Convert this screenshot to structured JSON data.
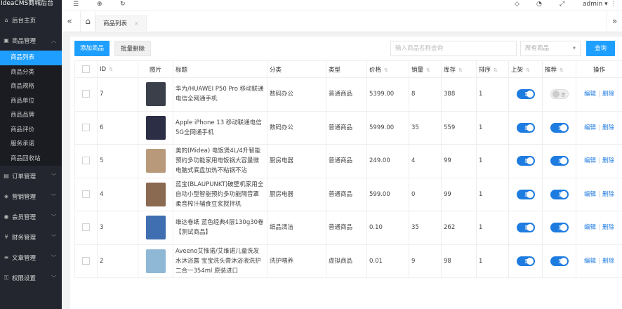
{
  "app": {
    "title": "IdeaCMS商城后台"
  },
  "sidebar": {
    "home": "后台主页",
    "goods": "商品管理",
    "sub": [
      "商品列表",
      "商品分类",
      "商品规格",
      "商品单位",
      "商品品牌",
      "商品评价",
      "服务承诺",
      "商品回收站"
    ],
    "groups": [
      "订单管理",
      "营销管理",
      "会员管理",
      "财务管理",
      "文章管理",
      "权限设置"
    ]
  },
  "topbar": {
    "user": "admin"
  },
  "tabs": {
    "current": "商品列表",
    "close": "×"
  },
  "toolbar": {
    "add": "添加商品",
    "batch_delete": "批量删除",
    "search_placeholder": "输入商品名称查询",
    "category_select": "所有商品",
    "search": "查询"
  },
  "table": {
    "headers": [
      "ID",
      "图片",
      "标题",
      "分类",
      "类型",
      "价格",
      "销量",
      "库存",
      "排序",
      "上架",
      "推荐",
      "操作"
    ],
    "rows": [
      {
        "id": "7",
        "title": "华为/HUAWEI P50 Pro 移动联通电信全网通手机",
        "cat": "数码办公",
        "type": "普通商品",
        "price": "5399.00",
        "sales": "8",
        "stock": "388",
        "sort": "1",
        "shelf": "是",
        "recommend": "否",
        "thumb": "#3a3f4a"
      },
      {
        "id": "6",
        "title": "Apple iPhone 13 移动联通电信5G全网通手机",
        "cat": "数码办公",
        "type": "普通商品",
        "price": "5999.00",
        "sales": "35",
        "stock": "559",
        "sort": "1",
        "shelf": "是",
        "recommend": "是",
        "thumb": "#2b2e45"
      },
      {
        "id": "5",
        "title": "美的(Midea) 电饭煲4L/4升智能预约多功能家用电饭锅大容量微电脑式底盘加热不粘锅不沾",
        "cat": "厨房电器",
        "type": "普通商品",
        "price": "249.00",
        "sales": "4",
        "stock": "99",
        "sort": "1",
        "shelf": "是",
        "recommend": "是",
        "thumb": "#b89a7a"
      },
      {
        "id": "4",
        "title": "蓝宝(BLAUPUNKT)破壁机家用全自动小型智能预约多功能隔音罩柔音榨汁辅食豆浆搅拌机",
        "cat": "厨房电器",
        "type": "普通商品",
        "price": "599.00",
        "sales": "0",
        "stock": "99",
        "sort": "1",
        "shelf": "是",
        "recommend": "是",
        "thumb": "#8b6a52"
      },
      {
        "id": "3",
        "title": "维达卷纸 蓝色经典4层130g30卷【测试商品】",
        "cat": "纸品清洁",
        "type": "普通商品",
        "price": "0.10",
        "sales": "35",
        "stock": "262",
        "sort": "1",
        "shelf": "是",
        "recommend": "是",
        "thumb": "#3f6fb0"
      },
      {
        "id": "2",
        "title": "Aveeno艾惟诺/艾维诺儿童洗发水沐浴露 宝宝洗头膏沐浴液洗护二合一354ml 原装进口",
        "cat": "洗护喂养",
        "type": "虚拟商品",
        "price": "0.01",
        "sales": "9",
        "stock": "98",
        "sort": "1",
        "shelf": "是",
        "recommend": "是",
        "thumb": "#8fb8d6"
      }
    ],
    "edit": "编辑",
    "delete": "删除"
  },
  "colors": {
    "accent": "#1e9fff",
    "sidebar": "#23262e",
    "switch_on": "#1e7be0"
  }
}
